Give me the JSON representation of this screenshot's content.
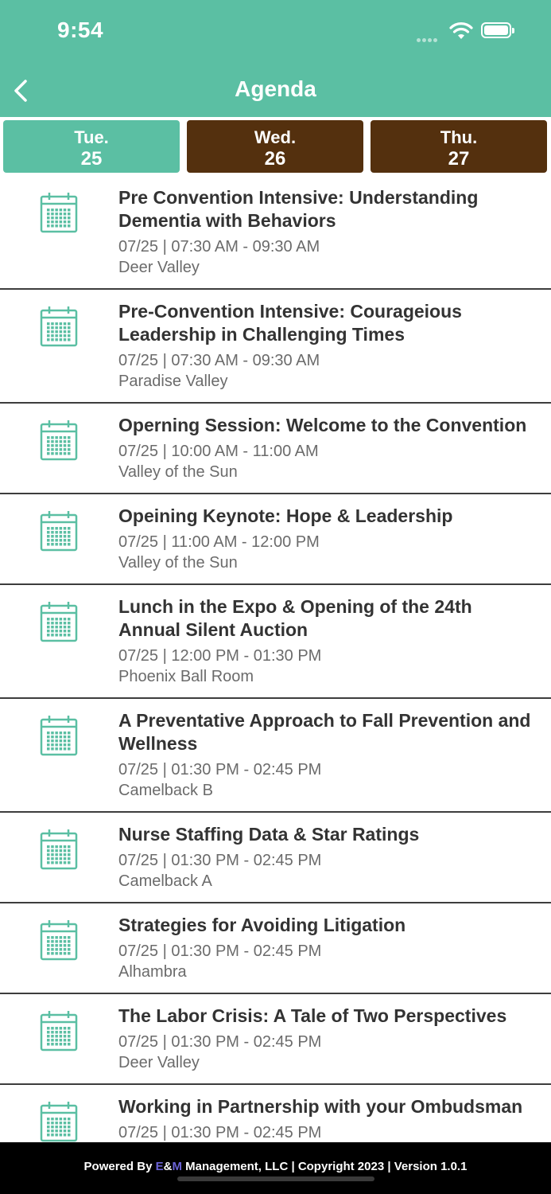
{
  "status_bar": {
    "time": "9:54"
  },
  "header": {
    "title": "Agenda"
  },
  "colors": {
    "accent": "#5bbfa3",
    "inactive_tab": "#54300e",
    "divider": "#3d3d3d",
    "footer_bg": "#000000"
  },
  "tabs": [
    {
      "day": "Tue.",
      "date": "25",
      "active": true
    },
    {
      "day": "Wed.",
      "date": "26",
      "active": false
    },
    {
      "day": "Thu.",
      "date": "27",
      "active": false
    }
  ],
  "sessions": [
    {
      "title": "Pre Convention Intensive: Understanding Dementia with Behaviors",
      "time": "07/25 | 07:30 AM - 09:30 AM",
      "location": "Deer Valley",
      "icon": "calendar-icon"
    },
    {
      "title": "Pre-Convention Intensive: Courageious Leadership in Challenging Times",
      "time": "07/25 | 07:30 AM - 09:30 AM",
      "location": "Paradise Valley",
      "icon": "calendar-icon"
    },
    {
      "title": "Operning Session: Welcome to the Convention",
      "time": "07/25 | 10:00 AM - 11:00 AM",
      "location": "Valley of the Sun",
      "icon": "calendar-icon"
    },
    {
      "title": "Opeining Keynote: Hope & Leadership",
      "time": "07/25 | 11:00 AM - 12:00 PM",
      "location": "Valley of the Sun",
      "icon": "calendar-icon"
    },
    {
      "title": "Lunch in the Expo & Opening of the 24th Annual Silent Auction",
      "time": "07/25 | 12:00 PM - 01:30 PM",
      "location": "Phoenix Ball Room",
      "icon": "calendar-icon"
    },
    {
      "title": "A Preventative Approach to Fall Prevention and Wellness",
      "time": "07/25 | 01:30 PM - 02:45 PM",
      "location": "Camelback B",
      "icon": "calendar-icon"
    },
    {
      "title": "Nurse Staffing Data & Star Ratings",
      "time": "07/25 | 01:30 PM - 02:45 PM",
      "location": "Camelback A",
      "icon": "calendar-icon"
    },
    {
      "title": "Strategies for Avoiding Litigation",
      "time": "07/25 | 01:30 PM - 02:45 PM",
      "location": "Alhambra",
      "icon": "calendar-icon"
    },
    {
      "title": "The Labor Crisis: A Tale of Two Perspectives",
      "time": "07/25 | 01:30 PM - 02:45 PM",
      "location": "Deer Valley",
      "icon": "calendar-icon"
    },
    {
      "title": "Working in Partnership with your Ombudsman",
      "time": "07/25 | 01:30 PM - 02:45 PM",
      "location": "",
      "icon": "calendar-icon"
    }
  ],
  "footer": {
    "prefix": "Powered By ",
    "e1": "E",
    "amp": "&",
    "e2": "M",
    "suffix": " Management, LLC | Copyright 2023 | Version 1.0.1"
  }
}
